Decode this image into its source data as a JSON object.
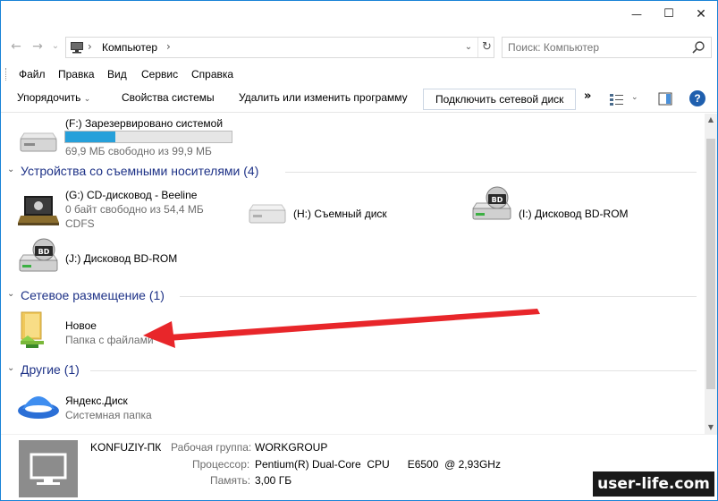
{
  "window": {
    "minimize_glyph": "—",
    "maximize_glyph": "☐",
    "close_glyph": "✕"
  },
  "nav": {
    "back_glyph": "←",
    "forward_glyph": "→",
    "recent_glyph": "⌄",
    "up_glyph": "↑"
  },
  "address": {
    "crumb": "Компьютер",
    "separator": "›",
    "dropdown_glyph": "⌄",
    "refresh_glyph": "↻"
  },
  "search": {
    "placeholder": "Поиск: Компьютер"
  },
  "menu": [
    "Файл",
    "Правка",
    "Вид",
    "Сервис",
    "Справка"
  ],
  "toolbar": {
    "organize": "Упорядочить",
    "organize_caret": "⌄",
    "system_props": "Свойства системы",
    "uninstall": "Удалить или изменить программу",
    "map_drive": "Подключить сетевой диск",
    "more": "»",
    "view_caret": "⌄",
    "help": "?"
  },
  "drives_top": {
    "name": "(F:) Зарезервировано системой",
    "free": "69,9 МБ свободно из 99,9 МБ",
    "used_fraction": 0.3
  },
  "groups": {
    "removable": "Устройства со съемными носителями (4)",
    "network": "Сетевое размещение (1)",
    "other": "Другие (1)",
    "chevron": "⌄"
  },
  "removable_items": [
    {
      "name": "(G:) CD-дисковод - Beeline",
      "sub": "0 байт свободно из 54,4 МБ",
      "sub2": "CDFS"
    },
    {
      "name": "(H:) Съемный диск"
    },
    {
      "name": "(I:) Дисковод BD-ROM",
      "badge": "BD"
    },
    {
      "name": "(J:) Дисковод BD-ROM",
      "badge": "BD"
    }
  ],
  "network_item": {
    "name": "Новое",
    "sub": "Папка с файлами"
  },
  "other_item": {
    "name": "Яндекс.Диск",
    "sub": "Системная папка"
  },
  "details": {
    "pc_name": "KONFUZIY-ПК",
    "workgroup_label": "Рабочая группа:",
    "workgroup": "WORKGROUP",
    "cpu_label": "Процессор:",
    "cpu": "Pentium(R) Dual-Core  CPU      E6500  @ 2,93GHz",
    "mem_label": "Память:",
    "mem": "3,00 ГБ"
  },
  "scroll": {
    "up": "▲",
    "down": "▼"
  },
  "watermark": "user-life.com",
  "colors": {
    "accent": "#26a0da",
    "group_title": "#1e3287",
    "arrow": "#e8262a"
  }
}
